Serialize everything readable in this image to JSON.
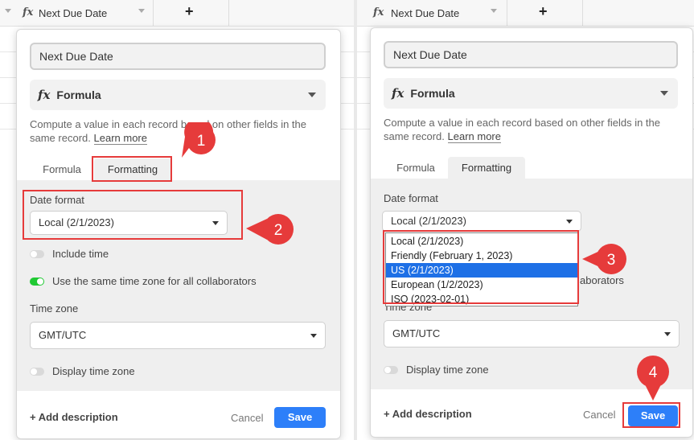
{
  "left": {
    "header": {
      "column_name": "Next Due Date",
      "add_column": "+"
    },
    "field_name": "Next Due Date",
    "field_type": "Formula",
    "description": "Compute a value in each record based on other fields in the",
    "description_line2": "same record.",
    "learn_more": "Learn more",
    "tabs": [
      {
        "label": "Formula"
      },
      {
        "label": "Formatting"
      }
    ],
    "date_format_label": "Date format",
    "date_format_value": "Local (2/1/2023)",
    "include_time_label": "Include time",
    "same_timezone_label": "Use the same time zone for all collaborators",
    "time_zone_label": "Time zone",
    "time_zone_value": "GMT/UTC",
    "display_time_zone_label": "Display time zone",
    "add_description": "+ Add description",
    "cancel": "Cancel",
    "save": "Save",
    "callouts": {
      "one": "1",
      "two": "2"
    }
  },
  "right": {
    "header": {
      "column_name": "Next Due Date",
      "add_column": "+"
    },
    "field_name": "Next Due Date",
    "field_type": "Formula",
    "description": "Compute a value in each record based on other fields in the",
    "description_line2": "same record.",
    "learn_more": "Learn more",
    "tabs": [
      {
        "label": "Formula"
      },
      {
        "label": "Formatting"
      }
    ],
    "date_format_label": "Date format",
    "date_format_value": "Local (2/1/2023)",
    "date_format_options": [
      "Local (2/1/2023)",
      "Friendly (February 1, 2023)",
      "US (2/1/2023)",
      "European (1/2/2023)",
      "ISO (2023-02-01)"
    ],
    "selected_option": "US (2/1/2023)",
    "same_timezone_fragment": "aborators",
    "time_zone_label": "Time zone",
    "time_zone_value": "GMT/UTC",
    "display_time_zone_label": "Display time zone",
    "add_description": "+ Add description",
    "cancel": "Cancel",
    "save": "Save",
    "callouts": {
      "three": "3",
      "four": "4"
    }
  },
  "colors": {
    "accent": "#2d7ff9",
    "annotation_red": "#e63b3b",
    "toggle_on": "#20c933",
    "selected_option": "#1e70e6"
  }
}
